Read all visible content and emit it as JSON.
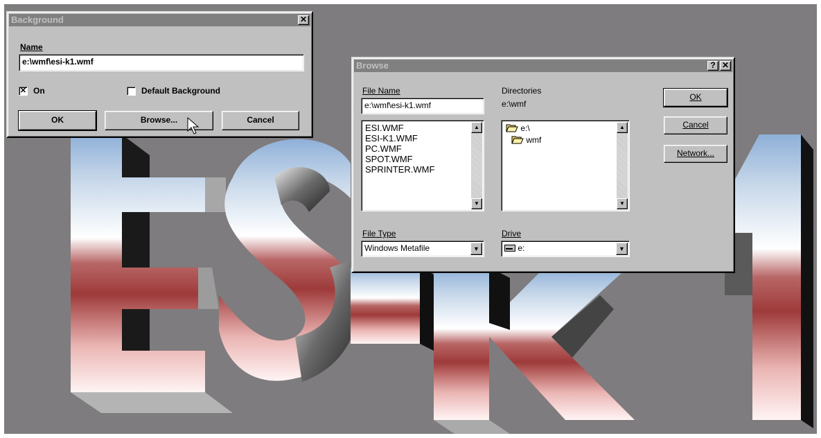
{
  "background_dialog": {
    "title": "Background",
    "close_glyph": "✕",
    "name_label": "Name",
    "name_value": "e:\\wmf\\esi-k1.wmf",
    "on_label": "On",
    "on_checked": true,
    "default_bg_label": "Default Background",
    "default_bg_checked": false,
    "ok_label": "OK",
    "browse_label": "Browse...",
    "cancel_label": "Cancel"
  },
  "browse_dialog": {
    "title": "Browse",
    "help_glyph": "?",
    "close_glyph": "✕",
    "file_name_label": "File Name",
    "file_name_value": "e:\\wmf\\esi-k1.wmf",
    "files": [
      "ESI.WMF",
      "ESI-K1.WMF",
      "PC.WMF",
      "SPOT.WMF",
      "SPRINTER.WMF"
    ],
    "directories_label": "Directories",
    "current_dir": "e:\\wmf",
    "dirs": [
      {
        "name": "e:\\",
        "icon": "open-folder-icon"
      },
      {
        "name": "wmf",
        "icon": "open-folder-icon"
      }
    ],
    "file_type_label": "File Type",
    "file_type_value": "Windows Metafile",
    "drive_label": "Drive",
    "drive_value": "e:",
    "ok_label": "OK",
    "cancel_label": "Cancel",
    "network_label": "Network..."
  },
  "wallpaper": {
    "text": "ESI-K1",
    "colors": {
      "desktop": "#7e7c7e",
      "sky": "#8fb0d8",
      "white": "#ffffff",
      "red": "#a63c3c",
      "pink": "#e8b0ae"
    }
  }
}
